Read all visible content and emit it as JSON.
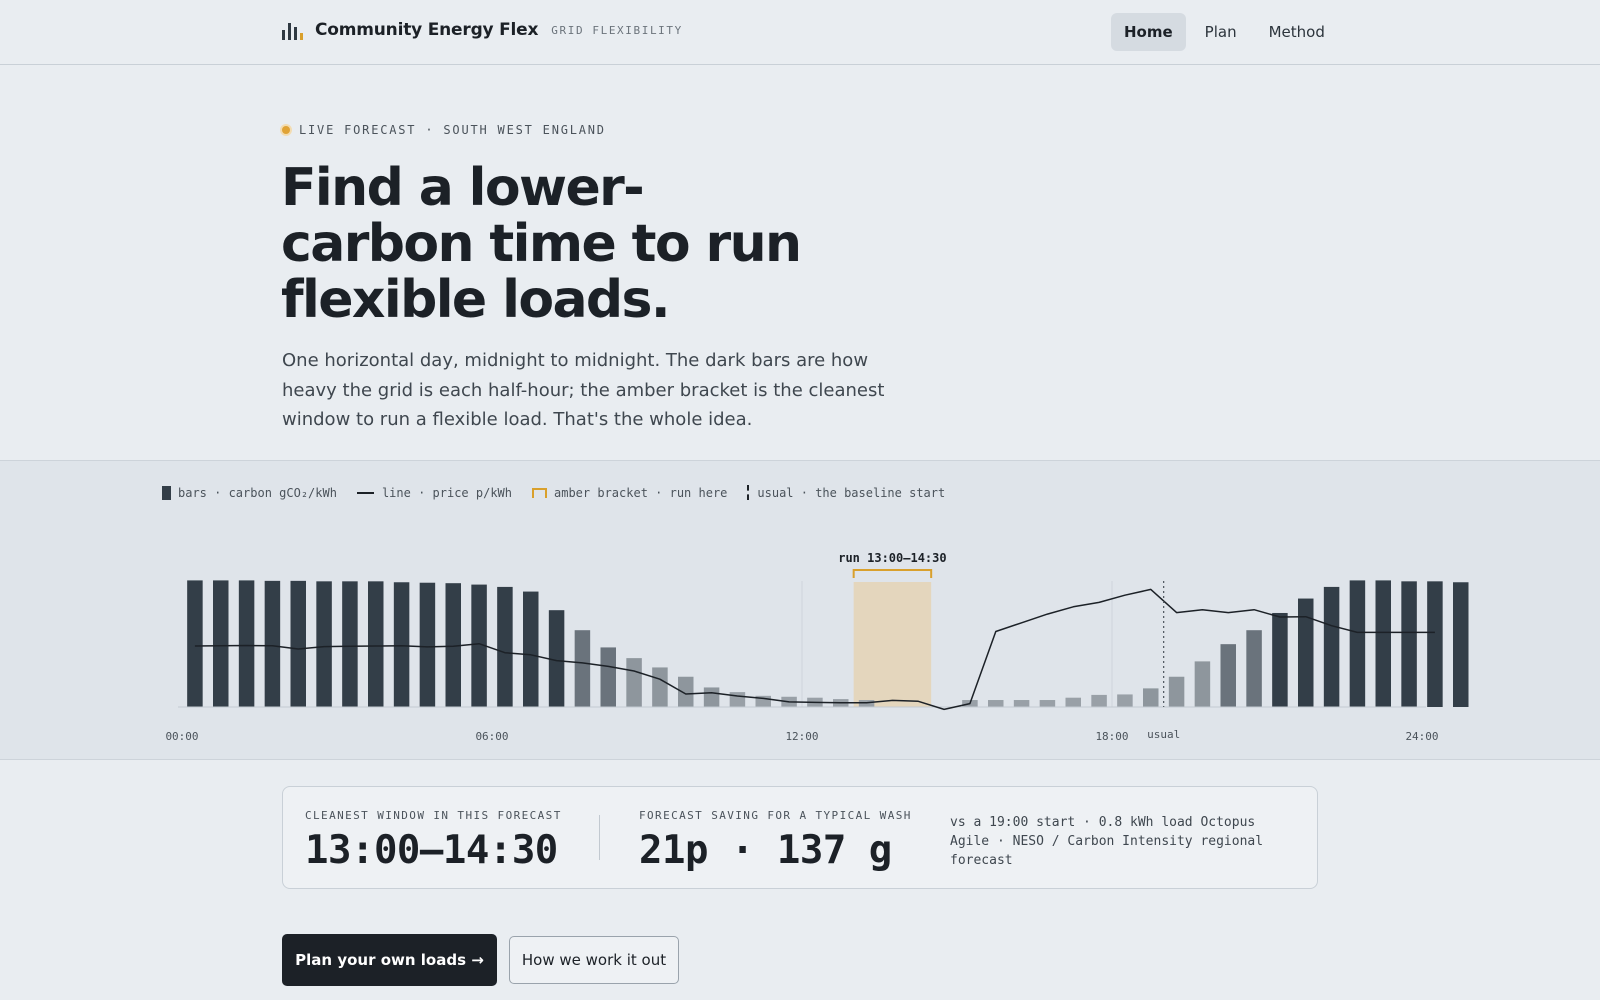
{
  "header": {
    "brand_name": "Community Energy Flex",
    "brand_tag": "GRID FLEXIBILITY",
    "nav": [
      {
        "label": "Home",
        "active": true
      },
      {
        "label": "Plan",
        "active": false
      },
      {
        "label": "Method",
        "active": false
      }
    ]
  },
  "hero": {
    "eyebrow": "LIVE FORECAST · SOUTH WEST ENGLAND",
    "title": "Find a lower-carbon time to run flexible loads.",
    "lede": "One horizontal day, midnight to midnight. The dark bars are how heavy the grid is each half-hour; the amber bracket is the cleanest window to run a flexible load. That's the whole idea."
  },
  "legend": {
    "bars": "bars · carbon gCO₂/kWh",
    "line": "line · price p/kWh",
    "bracket": "amber bracket · run here",
    "usual": "usual · the baseline start"
  },
  "chart_data": {
    "type": "bar",
    "x_ticks": [
      "00:00",
      "06:00",
      "12:00",
      "18:00",
      "24:00"
    ],
    "carbon_gco2_per_kwh": [
      272,
      272,
      272,
      271,
      271,
      270,
      270,
      270,
      268,
      267,
      266,
      263,
      258,
      248,
      208,
      165,
      128,
      105,
      85,
      65,
      42,
      32,
      24,
      22,
      20,
      17,
      15,
      0,
      0,
      0,
      15,
      15,
      15,
      15,
      20,
      26,
      27,
      40,
      65,
      98,
      135,
      165,
      202,
      233,
      258,
      272,
      272,
      270,
      270,
      268
    ],
    "price_p_per_kwh": [
      22.0,
      22.1,
      22.2,
      22.1,
      21.0,
      21.8,
      21.9,
      22.0,
      22.1,
      21.7,
      21.9,
      22.8,
      19.7,
      19.0,
      17.0,
      16.2,
      15.0,
      13.4,
      10.6,
      5.5,
      5.9,
      4.8,
      4.0,
      2.8,
      2.6,
      2.5,
      2.5,
      3.3,
      3.0,
      0.2,
      2.2,
      27.0,
      30.0,
      33.0,
      35.5,
      37.0,
      39.5,
      41.5,
      33.5,
      34.5,
      33.5,
      34.5,
      32.0,
      32.1,
      29.0,
      26.7,
      26.7,
      26.7,
      26.7
    ],
    "window": {
      "start": "13:00",
      "end": "14:30",
      "label": "run 13:00–14:30"
    },
    "usual": {
      "time": "19:00",
      "label": "usual"
    },
    "legend_placement": "top-left"
  },
  "stats": {
    "window_label": "CLEANEST WINDOW IN THIS FORECAST",
    "window_value": "13:00–14:30",
    "saving_label": "FORECAST SAVING FOR A TYPICAL WASH",
    "saving_value": "21p · 137 g",
    "note": "vs a 19:00 start · 0.8 kWh load Octopus Agile · NESO / Carbon Intensity regional forecast"
  },
  "actions": {
    "primary": "Plan your own loads →",
    "secondary": "How we work it out"
  },
  "colors": {
    "background": "#e9edf1",
    "band": "#dfe4ea",
    "ink": "#1c2127",
    "bar_dark": "#333e48",
    "bar_mid": "#6a737c",
    "bar_light": "#8e969d",
    "amber": "#d9a02c",
    "window_fill": "#e4d6bd"
  }
}
